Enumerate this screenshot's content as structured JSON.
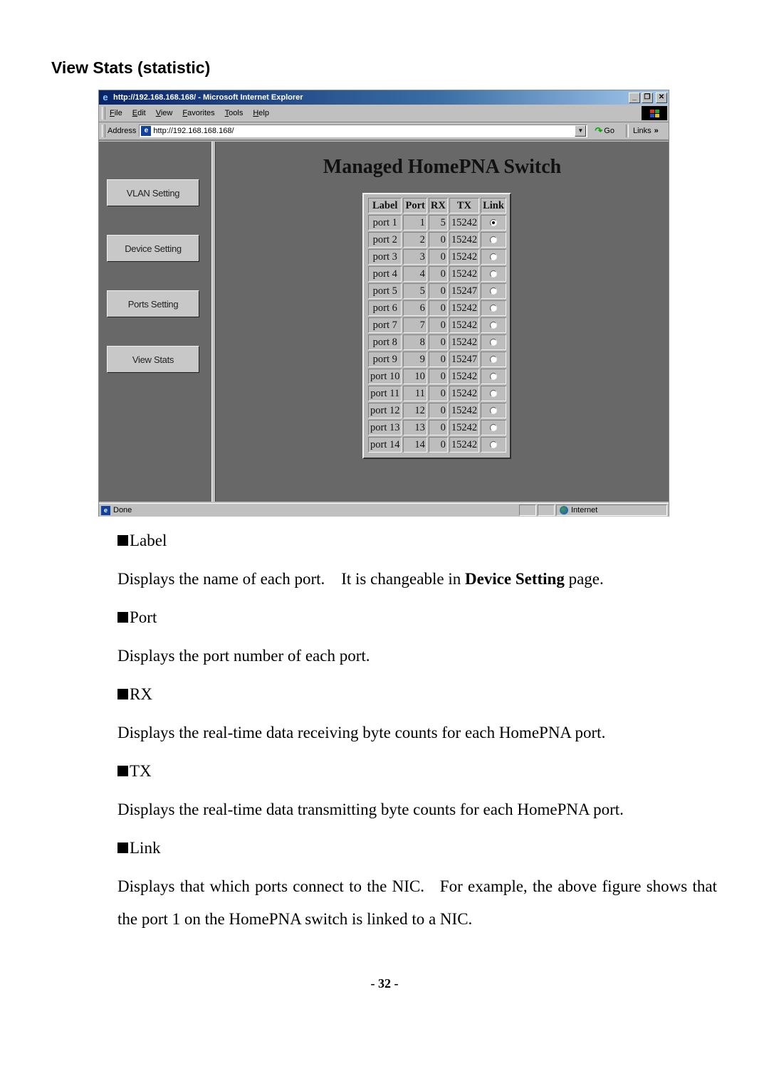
{
  "section_title": "View Stats (statistic)",
  "browser": {
    "title": "http://192.168.168.168/ - Microsoft Internet Explorer",
    "window_buttons": {
      "minimize": "_",
      "restore": "❐",
      "close": "✕"
    },
    "menu": [
      "File",
      "Edit",
      "View",
      "Favorites",
      "Tools",
      "Help"
    ],
    "address_label": "Address",
    "address_value": "http://192.168.168.168/",
    "go_label": "Go",
    "links_label": "Links",
    "links_chevron": "»",
    "status_text": "Done",
    "status_zone": "Internet"
  },
  "sidebar": {
    "buttons": [
      "VLAN Setting",
      "Device Setting",
      "Ports Setting",
      "View Stats"
    ]
  },
  "main": {
    "title": "Managed HomePNA Switch",
    "table": {
      "headers": [
        "Label",
        "Port",
        "RX",
        "TX",
        "Link"
      ],
      "rows": [
        {
          "label": "port 1",
          "port": "1",
          "rx": "5",
          "tx": "15242",
          "link": true
        },
        {
          "label": "port 2",
          "port": "2",
          "rx": "0",
          "tx": "15242",
          "link": false
        },
        {
          "label": "port 3",
          "port": "3",
          "rx": "0",
          "tx": "15242",
          "link": false
        },
        {
          "label": "port 4",
          "port": "4",
          "rx": "0",
          "tx": "15242",
          "link": false
        },
        {
          "label": "port 5",
          "port": "5",
          "rx": "0",
          "tx": "15247",
          "link": false
        },
        {
          "label": "port 6",
          "port": "6",
          "rx": "0",
          "tx": "15242",
          "link": false
        },
        {
          "label": "port 7",
          "port": "7",
          "rx": "0",
          "tx": "15242",
          "link": false
        },
        {
          "label": "port 8",
          "port": "8",
          "rx": "0",
          "tx": "15242",
          "link": false
        },
        {
          "label": "port 9",
          "port": "9",
          "rx": "0",
          "tx": "15247",
          "link": false
        },
        {
          "label": "port 10",
          "port": "10",
          "rx": "0",
          "tx": "15242",
          "link": false
        },
        {
          "label": "port 11",
          "port": "11",
          "rx": "0",
          "tx": "15242",
          "link": false
        },
        {
          "label": "port 12",
          "port": "12",
          "rx": "0",
          "tx": "15242",
          "link": false
        },
        {
          "label": "port 13",
          "port": "13",
          "rx": "0",
          "tx": "15242",
          "link": false
        },
        {
          "label": "port 14",
          "port": "14",
          "rx": "0",
          "tx": "15242",
          "link": false
        }
      ]
    }
  },
  "doc": {
    "items": [
      {
        "heading": "Label",
        "body_pre": "Displays the name of each port.    It is changeable in ",
        "body_bold": "Device Setting",
        "body_post": " page."
      },
      {
        "heading": "Port",
        "body": "Displays the port number of each port."
      },
      {
        "heading": "RX",
        "body": "Displays the real-time data receiving byte counts for each HomePNA port."
      },
      {
        "heading": "TX",
        "body": "Displays the real-time data transmitting byte counts for each HomePNA port."
      },
      {
        "heading": "Link",
        "body": "Displays that which ports connect to the NIC.   For example, the above figure shows that the port 1 on the HomePNA switch is linked to a NIC."
      }
    ],
    "page_number": "- 32 -"
  }
}
